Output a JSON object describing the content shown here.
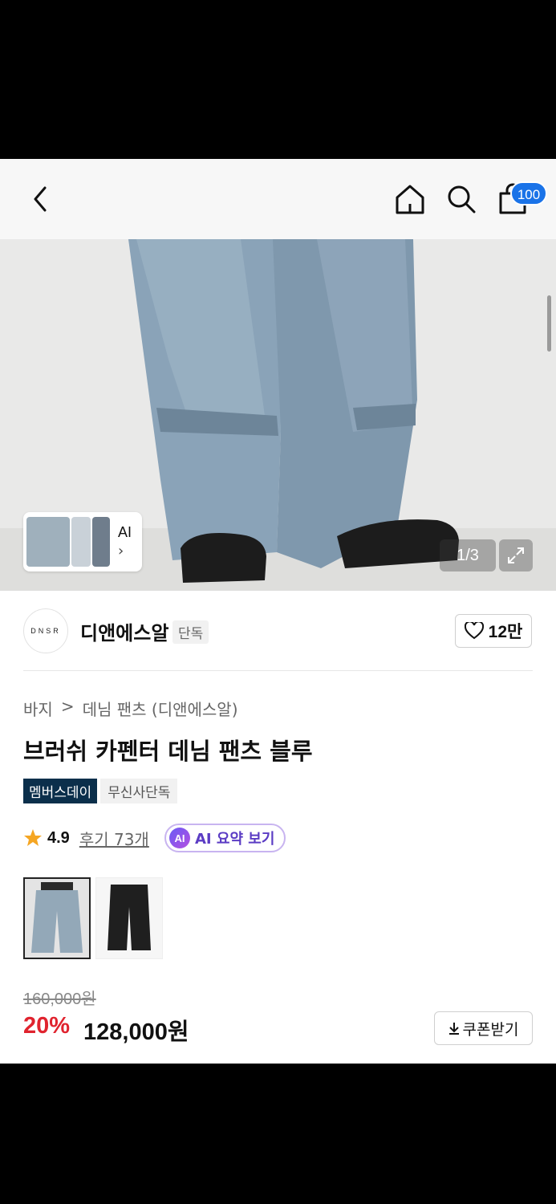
{
  "header": {
    "cart_badge": "100"
  },
  "gallery": {
    "ai_label": "AI",
    "ai_chevron": "›",
    "counter": "1/3",
    "current_index": 1,
    "total": 3
  },
  "brand": {
    "logo_text": "DNSR",
    "name": "디앤에스알",
    "exclusive_badge": "단독",
    "like_count": "12만"
  },
  "product": {
    "breadcrumb": [
      "바지",
      ">",
      "데님 팬츠 (디앤에스알)"
    ],
    "title": "브러쉬 카펜터 데님 팬츠 블루",
    "tags": [
      "멤버스데이",
      "무신사단독"
    ],
    "rating": "4.9",
    "reviews_label": "후기 73개",
    "ai_icon_text": "AI",
    "ai_summary_label": "AI 요약 보기",
    "swatches": [
      "blue-denim",
      "black-denim"
    ],
    "selected_swatch": 0
  },
  "price": {
    "original": "160,000원",
    "discount": "20%",
    "final": "128,000원",
    "coupon_label": "쿠폰받기"
  },
  "colors": {
    "accent_blue": "#1a73e8",
    "discount_red": "#e0232e",
    "tag_navy": "#0b2f4b",
    "ai_purple": "#5b3cc4"
  }
}
